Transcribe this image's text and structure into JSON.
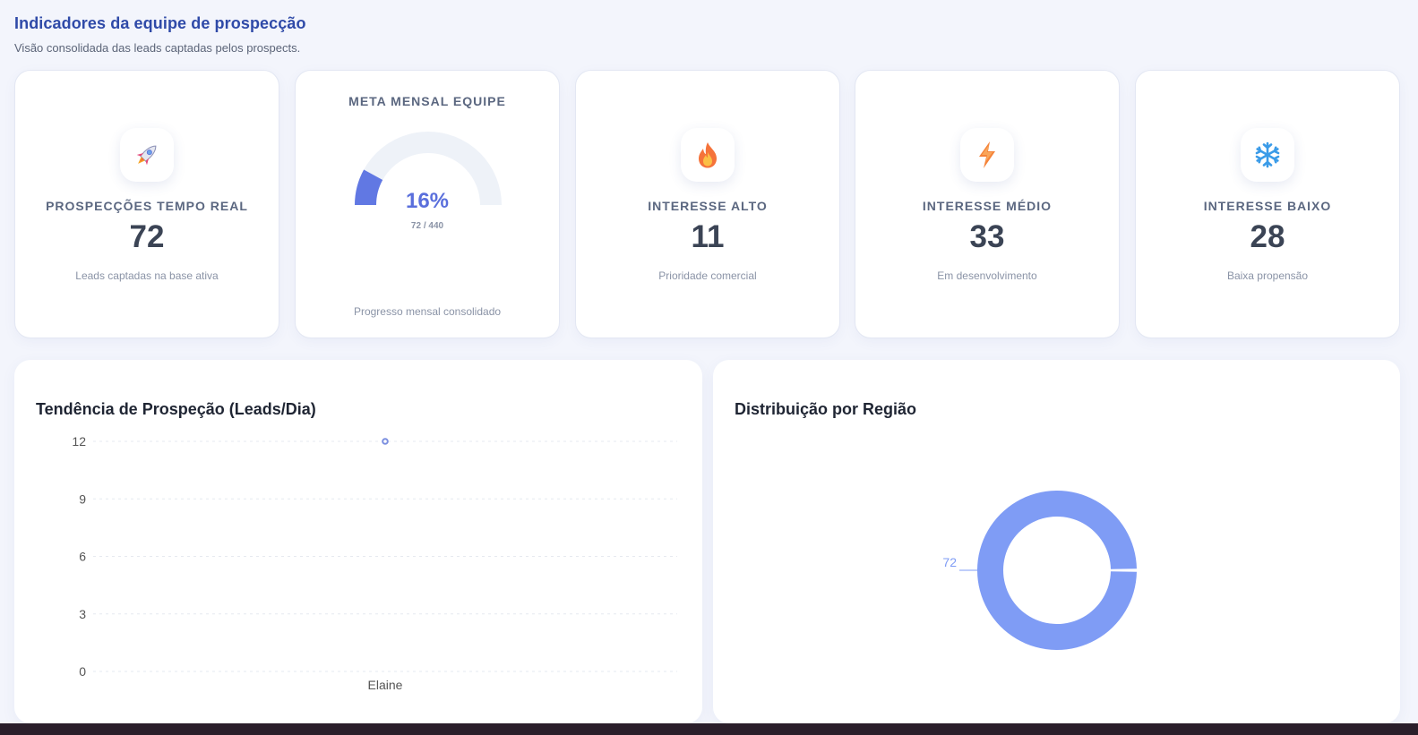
{
  "header": {
    "title": "Indicadores da equipe de prospecção",
    "subtitle": "Visão consolidada das leads captadas pelos prospects."
  },
  "kpis": [
    {
      "icon": "rocket-icon",
      "label": "PROSPECÇÕES TEMPO REAL",
      "value": "72",
      "caption": "Leads captadas na base ativa"
    },
    {
      "icon": "fire-icon",
      "label": "INTERESSE ALTO",
      "value": "11",
      "caption": "Prioridade comercial"
    },
    {
      "icon": "lightning-icon",
      "label": "INTERESSE MÉDIO",
      "value": "33",
      "caption": "Em desenvolvimento"
    },
    {
      "icon": "snowflake-icon",
      "label": "INTERESSE BAIXO",
      "value": "28",
      "caption": "Baixa propensão"
    }
  ],
  "meta": {
    "label": "META MENSAL EQUIPE",
    "percent_text": "16%",
    "fraction_text": "72 / 440",
    "progress": 0.16,
    "caption": "Progresso mensal consolidado",
    "colors": {
      "fill": "#6178e3",
      "track": "#eef2f8"
    }
  },
  "trend": {
    "title": "Tendência de Prospeção (Leads/Dia)",
    "chart_data": {
      "type": "scatter",
      "categories": [
        "Elaine"
      ],
      "values": [
        12
      ],
      "ylim": [
        0,
        12
      ],
      "yticks": [
        "0",
        "3",
        "6",
        "9",
        "12"
      ],
      "grid": true,
      "color": "#7b8fe0"
    }
  },
  "region": {
    "title": "Distribuição por Região",
    "chart_data": {
      "type": "pie",
      "donut": true,
      "values": [
        72
      ],
      "data_labels": [
        "72"
      ],
      "color": "#7f9cf5"
    }
  }
}
